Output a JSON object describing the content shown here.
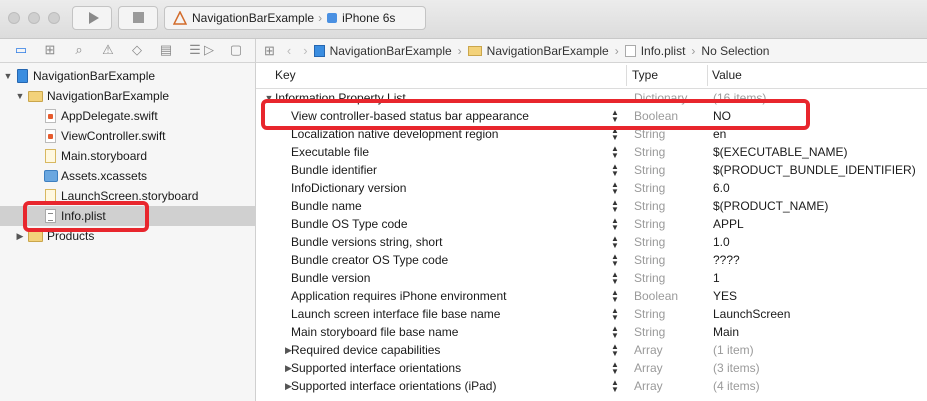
{
  "toolbar": {
    "scheme_target": "NavigationBarExample",
    "scheme_device": "iPhone 6s"
  },
  "navigator_tabs": [
    "folder-icon",
    "hierarchy-icon",
    "search-icon",
    "warning-icon",
    "diamond-icon",
    "test-icon",
    "debug-icon",
    "breakpoint-icon",
    "report-icon"
  ],
  "navigator": {
    "items": [
      {
        "label": "NavigationBarExample",
        "type": "project",
        "depth": 0,
        "disclosure": "open"
      },
      {
        "label": "NavigationBarExample",
        "type": "folder",
        "depth": 1,
        "disclosure": "open"
      },
      {
        "label": "AppDelegate.swift",
        "type": "swift",
        "depth": 2
      },
      {
        "label": "ViewController.swift",
        "type": "swift",
        "depth": 2
      },
      {
        "label": "Main.storyboard",
        "type": "storyboard",
        "depth": 2
      },
      {
        "label": "Assets.xcassets",
        "type": "assets",
        "depth": 2
      },
      {
        "label": "LaunchScreen.storyboard",
        "type": "storyboard",
        "depth": 2
      },
      {
        "label": "Info.plist",
        "type": "plist",
        "depth": 2,
        "selected": true
      },
      {
        "label": "Products",
        "type": "folder",
        "depth": 1,
        "disclosure": "closed"
      }
    ]
  },
  "jumpbar": {
    "crumbs": [
      "NavigationBarExample",
      "NavigationBarExample",
      "Info.plist",
      "No Selection"
    ]
  },
  "plist": {
    "headers": {
      "key": "Key",
      "type": "Type",
      "value": "Value"
    },
    "rows": [
      {
        "key": "Information Property List",
        "type": "Dictionary",
        "value": "(16 items)",
        "level": 0,
        "disclosure": "open",
        "stepper": false,
        "value_dim": true
      },
      {
        "key": "View controller-based status bar appearance",
        "type": "Boolean",
        "value": "NO",
        "level": 1,
        "stepper": true
      },
      {
        "key": "Localization native development region",
        "type": "String",
        "value": "en",
        "level": 1,
        "stepper": true
      },
      {
        "key": "Executable file",
        "type": "String",
        "value": "$(EXECUTABLE_NAME)",
        "level": 1,
        "stepper": true
      },
      {
        "key": "Bundle identifier",
        "type": "String",
        "value": "$(PRODUCT_BUNDLE_IDENTIFIER)",
        "level": 1,
        "stepper": true
      },
      {
        "key": "InfoDictionary version",
        "type": "String",
        "value": "6.0",
        "level": 1,
        "stepper": true
      },
      {
        "key": "Bundle name",
        "type": "String",
        "value": "$(PRODUCT_NAME)",
        "level": 1,
        "stepper": true
      },
      {
        "key": "Bundle OS Type code",
        "type": "String",
        "value": "APPL",
        "level": 1,
        "stepper": true
      },
      {
        "key": "Bundle versions string, short",
        "type": "String",
        "value": "1.0",
        "level": 1,
        "stepper": true
      },
      {
        "key": "Bundle creator OS Type code",
        "type": "String",
        "value": "????",
        "level": 1,
        "stepper": true
      },
      {
        "key": "Bundle version",
        "type": "String",
        "value": "1",
        "level": 1,
        "stepper": true
      },
      {
        "key": "Application requires iPhone environment",
        "type": "Boolean",
        "value": "YES",
        "level": 1,
        "stepper": true
      },
      {
        "key": "Launch screen interface file base name",
        "type": "String",
        "value": "LaunchScreen",
        "level": 1,
        "stepper": true
      },
      {
        "key": "Main storyboard file base name",
        "type": "String",
        "value": "Main",
        "level": 1,
        "stepper": true
      },
      {
        "key": "Required device capabilities",
        "type": "Array",
        "value": "(1 item)",
        "level": 1,
        "disclosure": "closed",
        "stepper": true,
        "value_dim": true
      },
      {
        "key": "Supported interface orientations",
        "type": "Array",
        "value": "(3 items)",
        "level": 1,
        "disclosure": "closed",
        "stepper": true,
        "value_dim": true
      },
      {
        "key": "Supported interface orientations (iPad)",
        "type": "Array",
        "value": "(4 items)",
        "level": 1,
        "disclosure": "closed",
        "stepper": true,
        "value_dim": true
      }
    ]
  },
  "highlight_color": "#e8262d"
}
